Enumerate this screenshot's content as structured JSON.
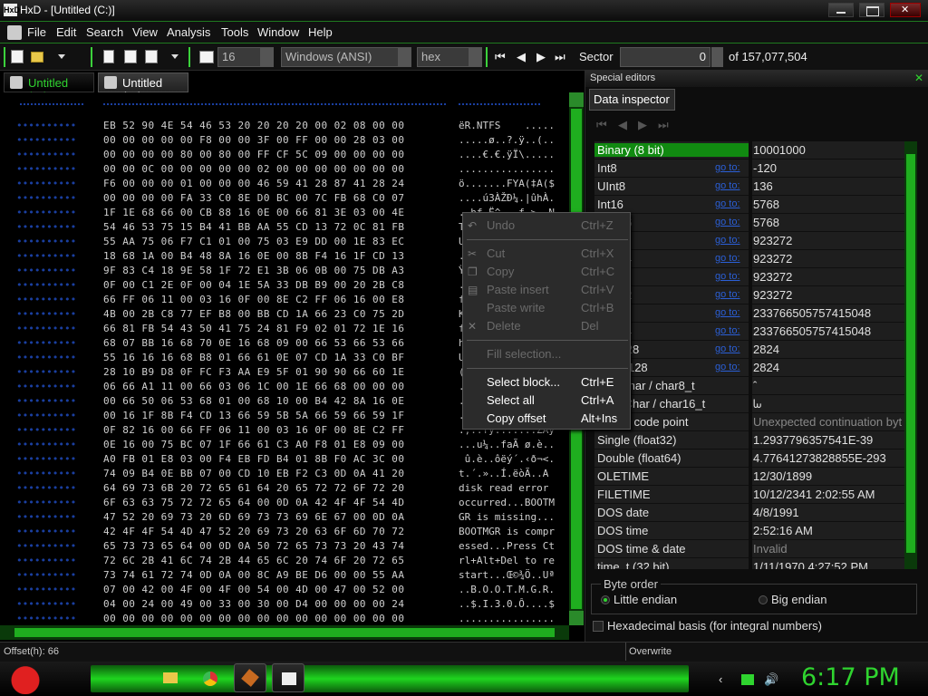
{
  "window": {
    "title": "HxD - [Untitled (C:)]",
    "app_icon": "HxD"
  },
  "menu": [
    "File",
    "Edit",
    "Search",
    "View",
    "Analysis",
    "Tools",
    "Window",
    "Help"
  ],
  "toolbar": {
    "bytes_per_row": "16",
    "charset": "Windows (ANSI)",
    "offset_base": "hex",
    "sector_label": "Sector",
    "sector_value": "0",
    "sector_total": "of 157,077,504"
  },
  "tabs": [
    {
      "label": "Untitled (C:)"
    },
    {
      "label": "Untitled (C:)"
    }
  ],
  "hex": {
    "rows": [
      {
        "hex": "EB 52 90 4E 54 46 53 20 20 20 20 00 02 08 00 00",
        "txt": "ëR.NTFS    ....."
      },
      {
        "hex": "00 00 00 00 00 F8 00 00 3F 00 FF 00 00 28 03 00",
        "txt": ".....ø..?.ÿ..(.."
      },
      {
        "hex": "00 00 00 00 80 00 80 00 FF CF 5C 09 00 00 00 00",
        "txt": "....€.€.ÿÏ\\....."
      },
      {
        "hex": "00 00 0C 00 00 00 00 00 02 00 00 00 00 00 00 00",
        "txt": "................"
      },
      {
        "hex": "F6 00 00 00 01 00 00 00 46 59 41 28 87 41 28 24",
        "txt": "ö.......FYA(‡A($"
      },
      {
        "hex": "00 00 00 00 FA 33 C0 8E D0 BC 00 7C FB 68 C0 07",
        "txt": "....ú3ÀŽĐ¼.|ûhÀ."
      },
      {
        "hex": "1F 1E 68 66 00 CB 88 16 0E 00 66 81 3E 03 00 4E",
        "txt": "..hf.Ë^...f.>..N"
      },
      {
        "hex": "54 46 53 75 15 B4 41 BB AA 55 CD 13 72 0C 81 FB",
        "txt": "TFSu.´A»ªUÍ.r..û"
      },
      {
        "hex": "55 AA 75 06 F7 C1 01 00 75 03 E9 DD 00 1E 83 EC",
        "txt": "Uªu.÷Á..u.éÝ...ì"
      },
      {
        "hex": "18 68 1A 00 B4 48 8A 16 0E 00 8B F4 16 1F CD 13",
        "txt": ".h..´HŠ...‹ô..Í."
      },
      {
        "hex": "9F 83 C4 18 9E 58 1F 72 E1 3B 06 0B 00 75 DB A3",
        "txt": "ŸƒÄ.žX.rá;...uÛ£"
      },
      {
        "hex": "0F 00 C1 2E 0F 00 04 1E 5A 33 DB B9 00 20 2B C8",
        "txt": "..Á.....Z3Û¹. +È"
      },
      {
        "hex": "66 FF 06 11 00 03 16 0F 00 8E C2 FF 06 16 00 E8",
        "txt": "fÿ.......ŽÂÿ...è"
      },
      {
        "hex": "4B 00 2B C8 77 EF B8 00 BB CD 1A 66 23 C0 75 2D",
        "txt": "K.+Èwï¸.»Í.f#Àu-"
      },
      {
        "hex": "66 81 FB 54 43 50 41 75 24 81 F9 02 01 72 1E 16",
        "txt": "f.ûTCPAu$.ù..r.."
      },
      {
        "hex": "68 07 BB 16 68 70 0E 16 68 09 00 66 53 66 53 66",
        "txt": "h.».hp..h..fSfSf"
      },
      {
        "hex": "55 16 16 16 68 B8 01 66 61 0E 07 CD 1A 33 C0 BF",
        "txt": "U...h¸.fa..Í.3À¿"
      },
      {
        "hex": "28 10 B9 D8 0F FC F3 AA E9 5F 01 90 90 66 60 1E",
        "txt": "(.¹Ø.üóªé_..f`."
      },
      {
        "hex": "06 66 A1 11 00 66 03 06 1C 00 1E 66 68 00 00 00",
        "txt": ".f¡..f.....fh..."
      },
      {
        "hex": "00 66 50 06 53 68 01 00 68 10 00 B4 42 8A 16 0E",
        "txt": ".fP.Sh..h..´BŠ.."
      },
      {
        "hex": "00 16 1F 8B F4 CD 13 66 59 5B 5A 66 59 66 59 1F",
        "txt": "...‹ôÍ.fY[ZfYfY."
      },
      {
        "hex": "0F 82 16 00 66 FF 06 11 00 03 16 0F 00 8E C2 FF",
        "txt": ".‚..fÿ.......ŽÂÿ"
      },
      {
        "hex": "0E 16 00 75 BC 07 1F 66 61 C3 A0 F8 01 E8 09 00",
        "txt": "...u¼..faÃ ø.è.."
      },
      {
        "hex": "A0 FB 01 E8 03 00 F4 EB FD B4 01 8B F0 AC 3C 00",
        "txt": " û.è..ôëý´.‹ð¬<."
      },
      {
        "hex": "74 09 B4 0E BB 07 00 CD 10 EB F2 C3 0D 0A 41 20",
        "txt": "t.´.»..Í.ëòÃ..A "
      },
      {
        "hex": "64 69 73 6B 20 72 65 61 64 20 65 72 72 6F 72 20",
        "txt": "disk read error "
      },
      {
        "hex": "6F 63 63 75 72 72 65 64 00 0D 0A 42 4F 4F 54 4D",
        "txt": "occurred...BOOTM"
      },
      {
        "hex": "47 52 20 69 73 20 6D 69 73 73 69 6E 67 00 0D 0A",
        "txt": "GR is missing..."
      },
      {
        "hex": "42 4F 4F 54 4D 47 52 20 69 73 20 63 6F 6D 70 72",
        "txt": "BOOTMGR is compr"
      },
      {
        "hex": "65 73 73 65 64 00 0D 0A 50 72 65 73 73 20 43 74",
        "txt": "essed...Press Ct"
      },
      {
        "hex": "72 6C 2B 41 6C 74 2B 44 65 6C 20 74 6F 20 72 65",
        "txt": "rl+Alt+Del to re"
      },
      {
        "hex": "73 74 61 72 74 0D 0A 00 8C A9 BE D6 00 00 55 AA",
        "txt": "start...Œ©¾Ö..Uª"
      },
      {
        "hex": "07 00 42 00 4F 00 4F 00 54 00 4D 00 47 00 52 00",
        "txt": "..B.O.O.T.M.G.R."
      },
      {
        "hex": "04 00 24 00 49 00 33 00 30 00 D4 00 00 00 00 24",
        "txt": "..$.I.3.0.Ô....$"
      },
      {
        "hex": "00 00 00 00 00 00 00 00 00 00 00 00 00 00 00 00",
        "txt": "................"
      }
    ]
  },
  "status": {
    "offset": "Offset(h): 66",
    "mode": "Overwrite"
  },
  "special_editors": {
    "title": "Special editors",
    "tab": "Data inspector",
    "rows": [
      {
        "label": "Binary (8 bit)",
        "value": "10001000",
        "selected": true
      },
      {
        "label": "Int8",
        "link": "go to:",
        "value": "-120"
      },
      {
        "label": "UInt8",
        "link": "go to:",
        "value": "136"
      },
      {
        "label": "Int16",
        "link": "go to:",
        "value": "5768"
      },
      {
        "label": "UInt16",
        "link": "go to:",
        "value": "5768"
      },
      {
        "label": "Int24",
        "link": "go to:",
        "value": "923272"
      },
      {
        "label": "UInt24",
        "link": "go to:",
        "value": "923272"
      },
      {
        "label": "Int32",
        "link": "go to:",
        "value": "923272"
      },
      {
        "label": "UInt32",
        "link": "go to:",
        "value": "923272"
      },
      {
        "label": "Int64",
        "link": "go to:",
        "value": "233766505757415048"
      },
      {
        "label": "UInt64",
        "link": "go to:",
        "value": "233766505757415048"
      },
      {
        "label": "LEB128",
        "link": "go to:",
        "value": "2824"
      },
      {
        "label": "ULEB128",
        "link": "go to:",
        "value": "2824"
      },
      {
        "label": "AnsiChar / char8_t",
        "value": "ˆ"
      },
      {
        "label": "WideChar / char16_t",
        "value": "ᘈ"
      },
      {
        "label": "UTF-8 code point",
        "value": "Unexpected continuation byt",
        "dim": true
      },
      {
        "label": "Single (float32)",
        "value": "1.2937796357541E-39"
      },
      {
        "label": "Double (float64)",
        "value": "4.77641273828855E-293"
      },
      {
        "label": "OLETIME",
        "value": "12/30/1899"
      },
      {
        "label": "FILETIME",
        "value": "10/12/2341 2:02:55 AM"
      },
      {
        "label": "DOS date",
        "value": "4/8/1991"
      },
      {
        "label": "DOS time",
        "value": "2:52:16 AM"
      },
      {
        "label": "DOS time & date",
        "value": "Invalid",
        "dim": true
      },
      {
        "label": "time_t (32 bit)",
        "value": "1/11/1970 4:27:52 PM"
      }
    ],
    "byte_order_label": "Byte order",
    "little_endian": "Little endian",
    "big_endian": "Big endian",
    "hex_basis": "Hexadecimal basis (for integral numbers)"
  },
  "context_menu": {
    "items": [
      {
        "label": "Undo",
        "key": "Ctrl+Z",
        "disabled": true,
        "icon": "undo-icon"
      },
      {
        "label": "Cut",
        "key": "Ctrl+X",
        "disabled": true,
        "icon": "scissors-icon"
      },
      {
        "label": "Copy",
        "key": "Ctrl+C",
        "disabled": true,
        "icon": "copy-icon"
      },
      {
        "label": "Paste insert",
        "key": "Ctrl+V",
        "disabled": true,
        "icon": "paste-icon"
      },
      {
        "label": "Paste write",
        "key": "Ctrl+B",
        "disabled": true
      },
      {
        "label": "Delete",
        "key": "Del",
        "disabled": true,
        "icon": "delete-icon"
      },
      {
        "label": "Fill selection...",
        "key": "",
        "disabled": true
      },
      {
        "label": "Select block...",
        "key": "Ctrl+E",
        "disabled": false
      },
      {
        "label": "Select all",
        "key": "Ctrl+A",
        "disabled": false
      },
      {
        "label": "Copy offset",
        "key": "Alt+Ins",
        "disabled": false
      }
    ]
  },
  "taskbar": {
    "clock": "6:17 PM"
  },
  "colors": {
    "accent": "#1fd41f",
    "link": "#2b5fd6",
    "selected": "#118a11"
  }
}
